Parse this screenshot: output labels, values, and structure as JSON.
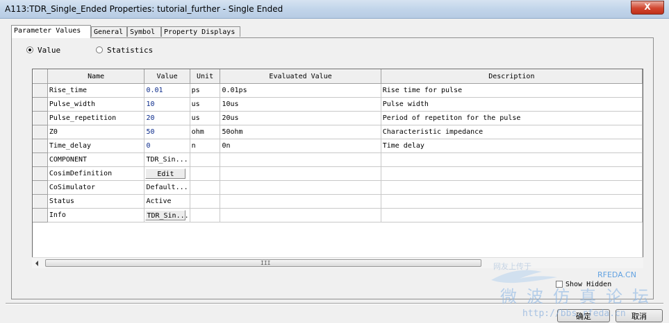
{
  "window": {
    "title": "A113:TDR_Single_Ended Properties: tutorial_further - Single Ended",
    "close_label": "X"
  },
  "tabs": [
    {
      "label": "Parameter Values",
      "active": true
    },
    {
      "label": "General",
      "active": false
    },
    {
      "label": "Symbol",
      "active": false
    },
    {
      "label": "Property Displays",
      "active": false
    }
  ],
  "display_mode": {
    "value_label": "Value",
    "statistics_label": "Statistics",
    "selected": "Value"
  },
  "grid": {
    "columns": [
      "Name",
      "Value",
      "Unit",
      "Evaluated Value",
      "Description"
    ],
    "rows": [
      {
        "name": "Rise_time",
        "value": "0.01",
        "unit": "ps",
        "evaluated": "0.01ps",
        "description": "Rise time for pulse"
      },
      {
        "name": "Pulse_width",
        "value": "10",
        "unit": "us",
        "evaluated": "10us",
        "description": "Pulse width"
      },
      {
        "name": "Pulse_repetition",
        "value": "20",
        "unit": "us",
        "evaluated": "20us",
        "description": "Period of repetiton for the pulse"
      },
      {
        "name": "Z0",
        "value": "50",
        "unit": "ohm",
        "evaluated": "50ohm",
        "description": "Characteristic impedance"
      },
      {
        "name": "Time_delay",
        "value": "0",
        "unit": "n",
        "evaluated": "0n",
        "description": "Time delay"
      },
      {
        "name": "COMPONENT",
        "value": "TDR_Sin...",
        "unit": "",
        "evaluated": "",
        "description": ""
      },
      {
        "name": "CosimDefinition",
        "value": "Edit",
        "unit": "",
        "evaluated": "",
        "description": ""
      },
      {
        "name": "CoSimulator",
        "value": "Default...",
        "unit": "",
        "evaluated": "",
        "description": ""
      },
      {
        "name": "Status",
        "value": "Active",
        "unit": "",
        "evaluated": "",
        "description": ""
      },
      {
        "name": "Info",
        "value": "TDR_Sin...",
        "unit": "",
        "evaluated": "",
        "description": ""
      }
    ]
  },
  "scrollbar": {
    "grip": "III"
  },
  "show_hidden": {
    "label": "Show Hidden",
    "checked": false
  },
  "buttons": {
    "ok": "确定",
    "cancel": "取消"
  },
  "watermark": {
    "brand": "RFEDA.CN",
    "chinese": "微波仿真论坛",
    "url": "http://bbs.rfeda.cn",
    "faint": "网友上传于"
  },
  "colors": {
    "value_text": "#0a2a8a",
    "title_gradient_top": "#d6e3f1",
    "close_button": "#c8402a"
  }
}
